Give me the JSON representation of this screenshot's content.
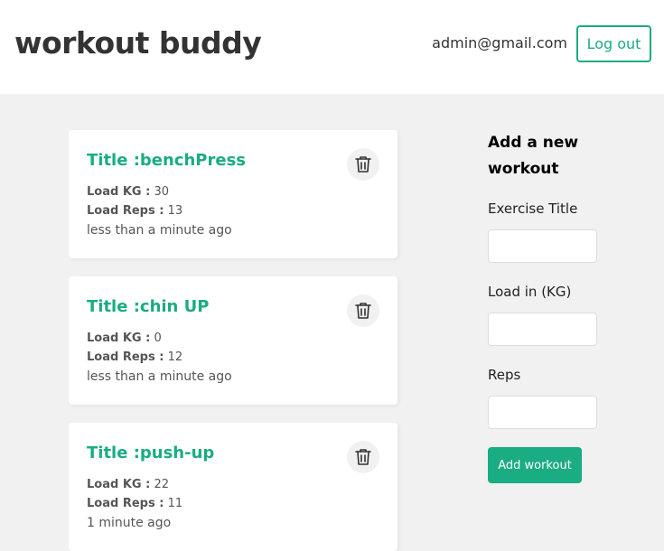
{
  "header": {
    "brand": "workout buddy",
    "user_email": "admin@gmail.com",
    "logout_label": "Log out"
  },
  "workouts": [
    {
      "title": "Title :benchPress",
      "load_label": "Load KG :",
      "load": "30",
      "reps_label": "Load Reps :",
      "reps": "13",
      "time": "less than a minute ago"
    },
    {
      "title": "Title :chin UP",
      "load_label": "Load KG :",
      "load": "0",
      "reps_label": "Load Reps :",
      "reps": "12",
      "time": "less than a minute ago"
    },
    {
      "title": "Title :push-up",
      "load_label": "Load KG :",
      "load": "22",
      "reps_label": "Load Reps :",
      "reps": "11",
      "time": "1 minute ago"
    }
  ],
  "form": {
    "heading": "Add a new workout",
    "title_label": "Exercise Title",
    "title_value": "",
    "load_label": "Load in (KG)",
    "load_value": "",
    "reps_label": "Reps",
    "reps_value": "",
    "submit_label": "Add workout"
  },
  "icons": {
    "delete": "trash-icon"
  },
  "colors": {
    "accent": "#1aac83",
    "background": "#f1f1f1"
  }
}
